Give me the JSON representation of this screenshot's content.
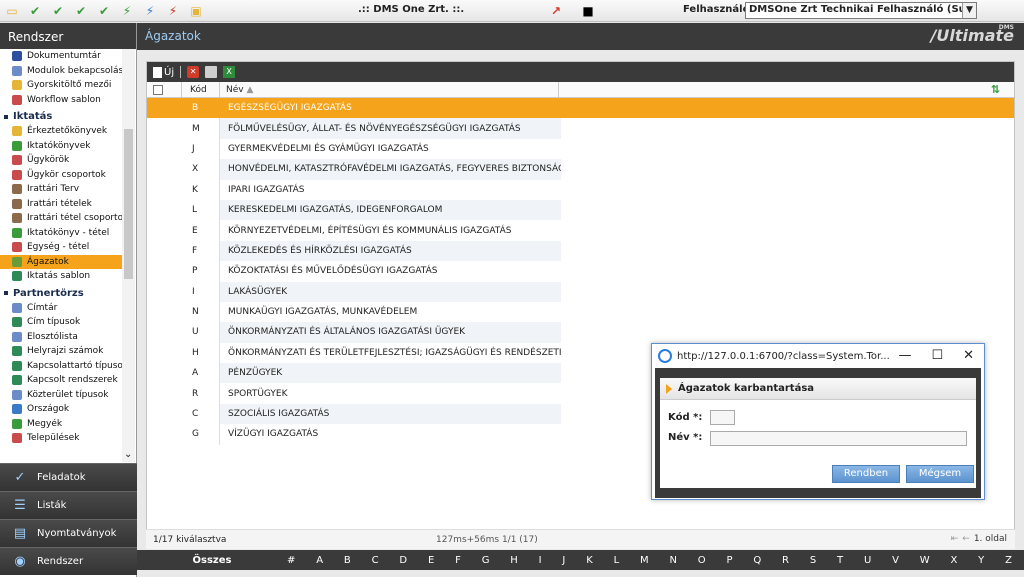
{
  "window": {
    "app_title": ".:: DMS One Zrt. ::.",
    "user_label": "Felhasználó:",
    "user_value": "DMSOne Zrt Technikai Felhasználó (Support)"
  },
  "sidebar": {
    "title": "Rendszer",
    "items": [
      {
        "label": "Dokumentumtár",
        "color": "#2b4f9e"
      },
      {
        "label": "Modulok bekapcsolása",
        "color": "#6b8cc7"
      },
      {
        "label": "Gyorskitöltő mezői",
        "color": "#e5b53a"
      },
      {
        "label": "Workflow sablon",
        "color": "#c94b4b"
      }
    ],
    "group_iktatas": "Iktatás",
    "iktatas_items": [
      {
        "label": "Érkeztetőkönyvek",
        "color": "#e5b53a"
      },
      {
        "label": "Iktatókönyvek",
        "color": "#3a9b3a"
      },
      {
        "label": "Ügykörök",
        "color": "#c94b4b"
      },
      {
        "label": "Ügykör csoportok",
        "color": "#c94b4b"
      },
      {
        "label": "Irattári Terv",
        "color": "#8b6b4b"
      },
      {
        "label": "Irattári tételek",
        "color": "#8b6b4b"
      },
      {
        "label": "Irattári tétel csoportok",
        "color": "#8b6b4b"
      },
      {
        "label": "Iktatókönyv - tétel",
        "color": "#3a9b3a"
      },
      {
        "label": "Egység - tétel",
        "color": "#c94b4b"
      },
      {
        "label": "Ágazatok",
        "color": "#6a9b3a",
        "selected": true
      },
      {
        "label": "Iktatás sablon",
        "color": "#2e8b57"
      }
    ],
    "group_partner": "Partnertörzs",
    "partner_items": [
      {
        "label": "Címtár",
        "color": "#6b8cc7"
      },
      {
        "label": "Cím típusok",
        "color": "#2e8b57"
      },
      {
        "label": "Elosztólista",
        "color": "#6b8cc7"
      },
      {
        "label": "Helyrajzi számok",
        "color": "#2e8b57"
      },
      {
        "label": "Kapcsolattartó típusok",
        "color": "#2e8b57"
      },
      {
        "label": "Kapcsolt rendszerek",
        "color": "#2e8b57"
      },
      {
        "label": "Közterület típusok",
        "color": "#6b8cc7"
      },
      {
        "label": "Országok",
        "color": "#3a7bc7"
      },
      {
        "label": "Megyék",
        "color": "#3a9b3a"
      },
      {
        "label": "Települések",
        "color": "#c94b4b"
      }
    ],
    "bottom": [
      {
        "label": "Feladatok",
        "icon": "check-icon"
      },
      {
        "label": "Listák",
        "icon": "list-icon"
      },
      {
        "label": "Nyomtatványok",
        "icon": "print-icon"
      },
      {
        "label": "Rendszer",
        "icon": "search-icon"
      }
    ]
  },
  "main": {
    "title": "Ágazatok",
    "brand": "/Ultimate",
    "brand_small": "DMS",
    "toolbar": {
      "new_label": "Új"
    },
    "columns": {
      "kod": "Kód",
      "nev": "Név"
    },
    "rows": [
      {
        "kod": "B",
        "nev": "EGÉSZSÉGÜGYI IGAZGATÁS",
        "selected": true
      },
      {
        "kod": "M",
        "nev": "FÖLMŰVELÉSÜGY, ÁLLAT- ÉS NÖVÉNYEGÉSZSÉGÜGYI IGAZGATÁS"
      },
      {
        "kod": "J",
        "nev": "GYERMEKVÉDELMI ÉS GYÁMÜGYI IGAZGATÁS"
      },
      {
        "kod": "X",
        "nev": "HONVÉDELMI, KATASZTRÓFAVÉDELMI IGAZGATÁS, FEGYVERES BIZTONSÁGI..."
      },
      {
        "kod": "K",
        "nev": "IPARI IGAZGATÁS"
      },
      {
        "kod": "L",
        "nev": "KERESKEDELMI IGAZGATÁS, IDEGENFORGALOM"
      },
      {
        "kod": "E",
        "nev": "KÖRNYEZETVÉDELMI, ÉPÍTÉSÜGYI ÉS KOMMUNÁLIS IGAZGATÁS"
      },
      {
        "kod": "F",
        "nev": "KÖZLEKEDÉS ÉS HÍRKÖZLÉSI IGAZGATÁS"
      },
      {
        "kod": "P",
        "nev": "KÖZOKTATÁSI ÉS MŰVELŐDÉSÜGYI IGAZGATÁS"
      },
      {
        "kod": "I",
        "nev": "LAKÁSÜGYEK"
      },
      {
        "kod": "N",
        "nev": "MUNKAÜGYI IGAZGATÁS, MUNKAVÉDELEM"
      },
      {
        "kod": "U",
        "nev": "ÖNKORMÁNYZATI ÉS ÁLTALÁNOS IGAZGATÁSI ÜGYEK"
      },
      {
        "kod": "H",
        "nev": "ÖNKORMÁNYZATI ÉS TERÜLETFEJLESZTÉSI; IGAZSÁGÜGYI ÉS RENDÉSZETI I..."
      },
      {
        "kod": "A",
        "nev": "PÉNZÜGYEK"
      },
      {
        "kod": "R",
        "nev": "SPORTÜGYEK"
      },
      {
        "kod": "C",
        "nev": "SZOCIÁLIS IGAZGATÁS"
      },
      {
        "kod": "G",
        "nev": "VÍZÜGYI IGAZGATÁS"
      }
    ],
    "status": {
      "selection": "1/17 kiválasztva",
      "timing": "127ms+56ms 1/1 (17)",
      "page": "1. oldal"
    },
    "alphabet": {
      "all_label": "Összes",
      "letters": [
        "#",
        "A",
        "B",
        "C",
        "D",
        "E",
        "F",
        "G",
        "H",
        "I",
        "J",
        "K",
        "L",
        "M",
        "N",
        "O",
        "P",
        "Q",
        "R",
        "S",
        "T",
        "U",
        "V",
        "W",
        "X",
        "Y",
        "Z"
      ]
    }
  },
  "dialog": {
    "url": "http://127.0.0.1:6700/?class=System.Tor...",
    "header": "Ágazatok karbantartása",
    "kod_label": "Kód *:",
    "nev_label": "Név *:",
    "kod_value": "",
    "nev_value": "",
    "ok_label": "Rendben",
    "cancel_label": "Mégsem"
  }
}
